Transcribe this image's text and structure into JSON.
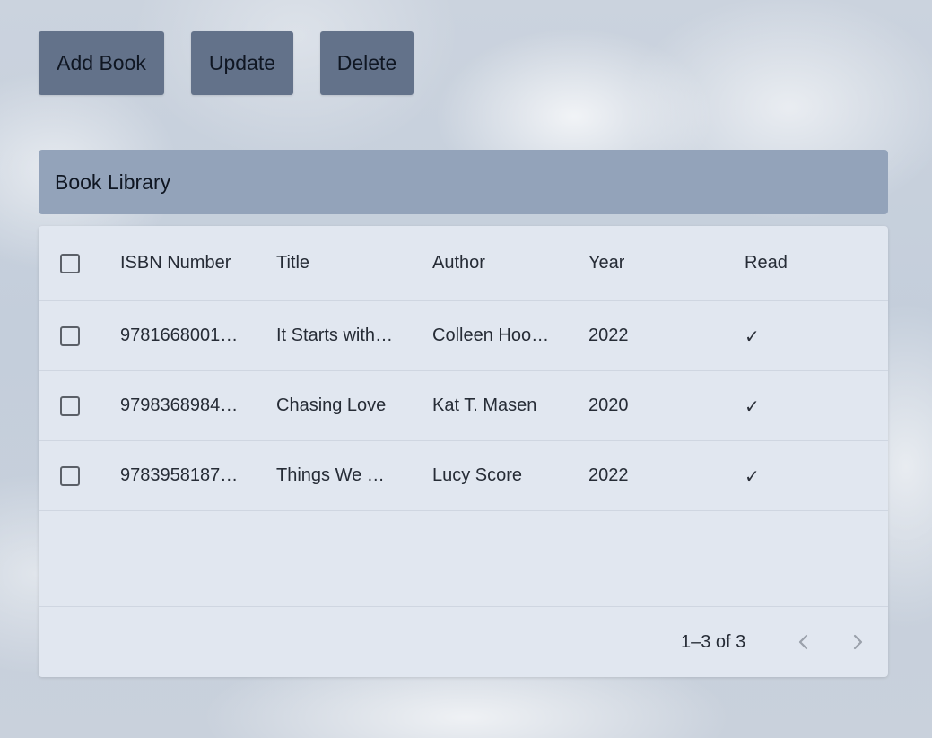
{
  "toolbar": {
    "add_label": "Add Book",
    "update_label": "Update",
    "delete_label": "Delete"
  },
  "library": {
    "title": "Book Library"
  },
  "table": {
    "columns": {
      "isbn": "ISBN Number",
      "title": "Title",
      "author": "Author",
      "year": "Year",
      "read": "Read"
    },
    "rows": [
      {
        "isbn": "9781668001…",
        "title": "It Starts with…",
        "author": "Colleen Hoo…",
        "year": "2022",
        "read": "✓"
      },
      {
        "isbn": "9798368984…",
        "title": "Chasing Love",
        "author": "Kat T. Masen",
        "year": "2020",
        "read": "✓"
      },
      {
        "isbn": "9783958187…",
        "title": "Things We …",
        "author": "Lucy Score",
        "year": "2022",
        "read": "✓"
      }
    ]
  },
  "pagination": {
    "range_label": "1–3 of 3",
    "prev_icon": "chevron-left-icon",
    "next_icon": "chevron-right-icon"
  },
  "colors": {
    "button_bg": "#63728a",
    "header_bar_bg": "#93a3ba",
    "grid_bg": "#e1e7f0"
  }
}
